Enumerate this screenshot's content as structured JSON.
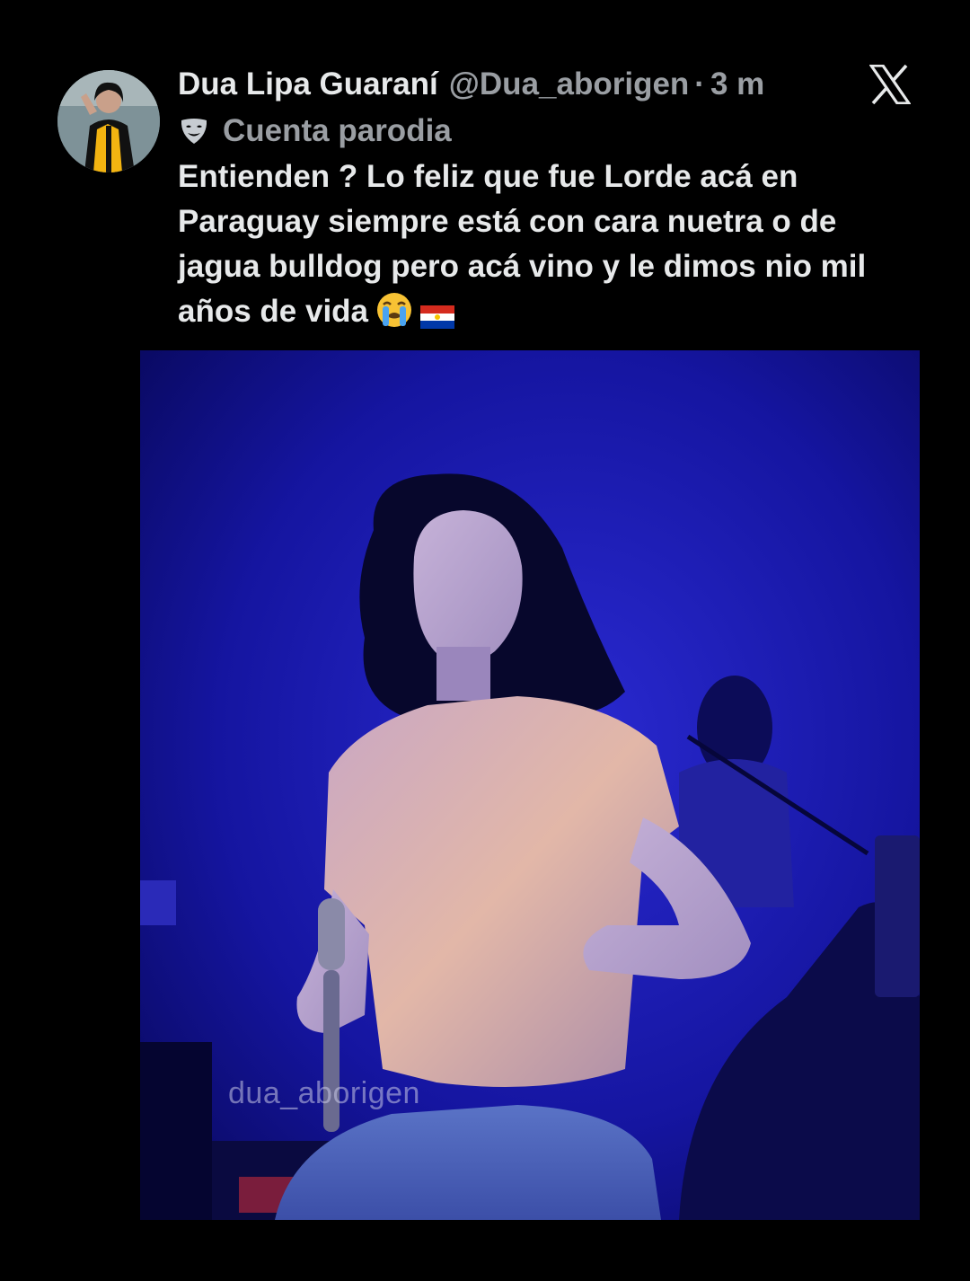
{
  "post": {
    "display_name": "Dua Lipa Guaraní",
    "handle": "@Dua_aborigen",
    "separator": "·",
    "time": "3 m",
    "parody_label": "Cuenta parodia",
    "text": "Entienden ? Lo feliz que fue Lorde acá en Paraguay siempre está con cara nuetra o de jagua bulldog pero acá vino y le dimos nio mil años de vida",
    "emojis": [
      "crying-face",
      "paraguay-flag"
    ]
  },
  "media": {
    "watermark": "dua_aborigen"
  },
  "brand": {
    "logo": "x-logo",
    "accent": "#e7e9ea",
    "secondary_text": "#9a9ea3",
    "background": "#000000"
  }
}
